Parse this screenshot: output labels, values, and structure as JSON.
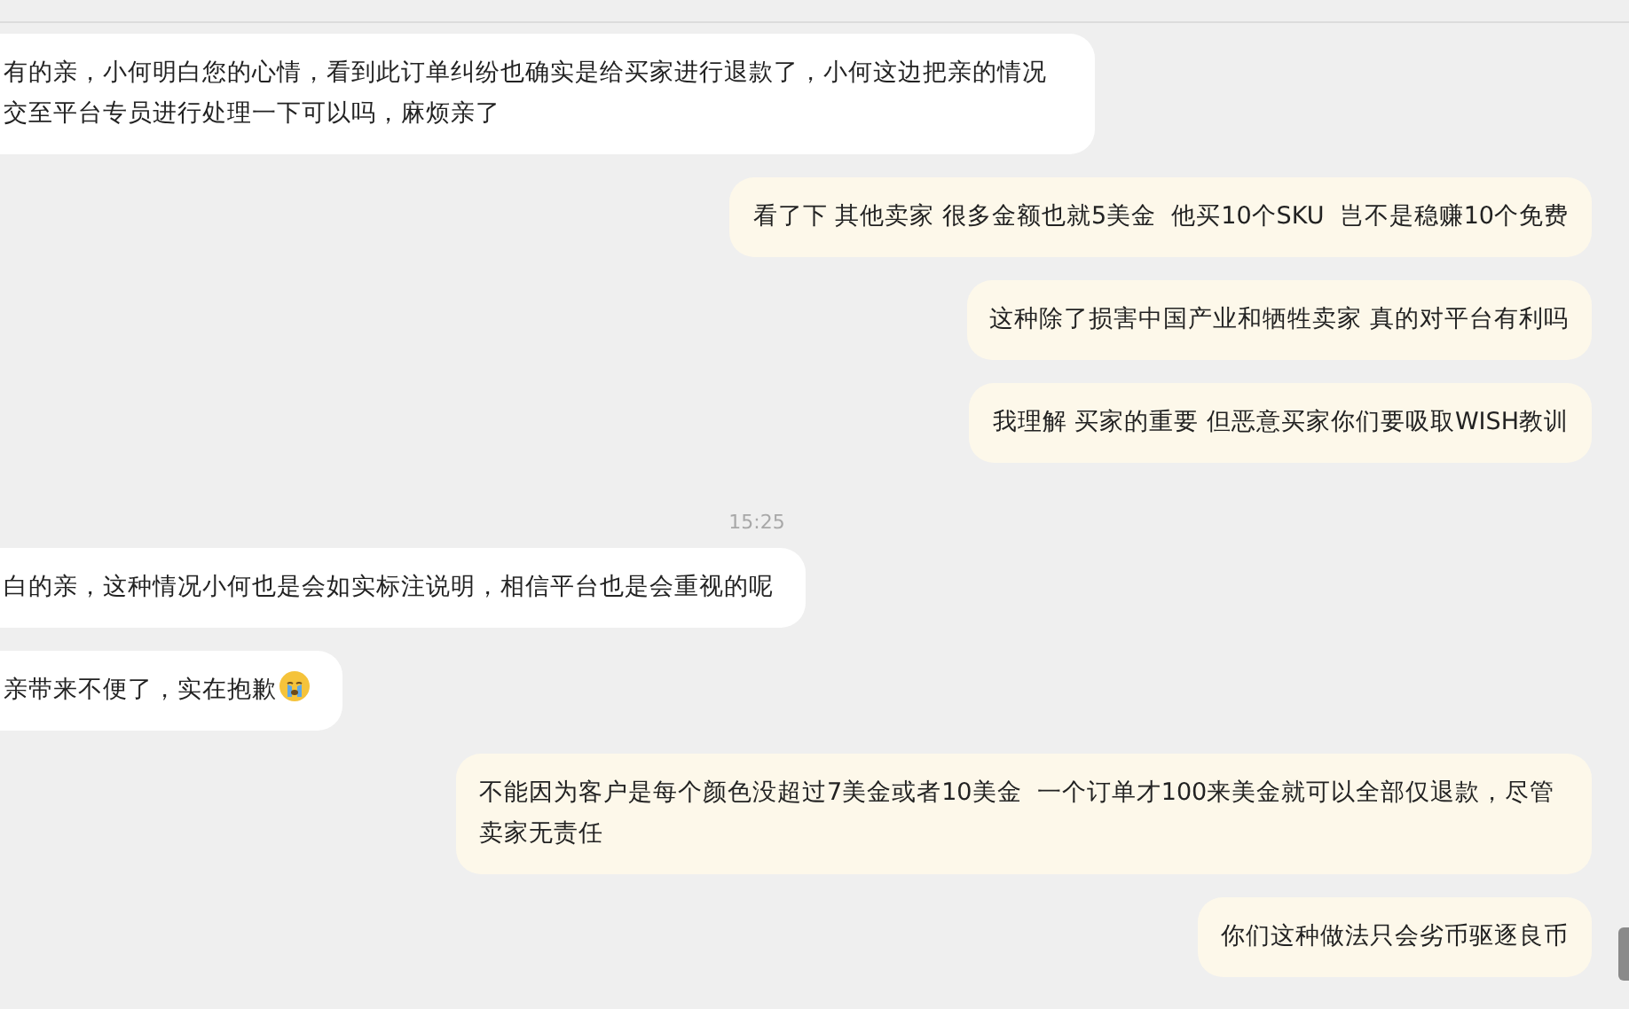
{
  "messages": [
    {
      "kind": "incoming",
      "text": "有的亲，小何明白您的心情，看到此订单纠纷也确实是给买家进行退款了，小何这边把亲的情况交至平台专员进行处理一下可以吗，麻烦亲了"
    },
    {
      "kind": "outgoing",
      "text": "看了下 其他卖家 很多金额也就5美金  他买10个SKU  岂不是稳赚10个免费"
    },
    {
      "kind": "outgoing",
      "text": "这种除了损害中国产业和牺牲卖家 真的对平台有利吗"
    },
    {
      "kind": "outgoing",
      "text": "我理解 买家的重要 但恶意买家你们要吸取WISH教训"
    },
    {
      "kind": "time",
      "text": "15:25"
    },
    {
      "kind": "incoming",
      "text": "白的亲，这种情况小何也是会如实标注说明，相信平台也是会重视的呢"
    },
    {
      "kind": "incoming",
      "text": "亲带来不便了，实在抱歉",
      "emoji": true
    },
    {
      "kind": "outgoing",
      "text": "不能因为客户是每个颜色没超过7美金或者10美金  一个订单才100来美金就可以全部仅退款，尽管卖家无责任"
    },
    {
      "kind": "outgoing",
      "text": "你们这种做法只会劣币驱逐良币"
    }
  ]
}
